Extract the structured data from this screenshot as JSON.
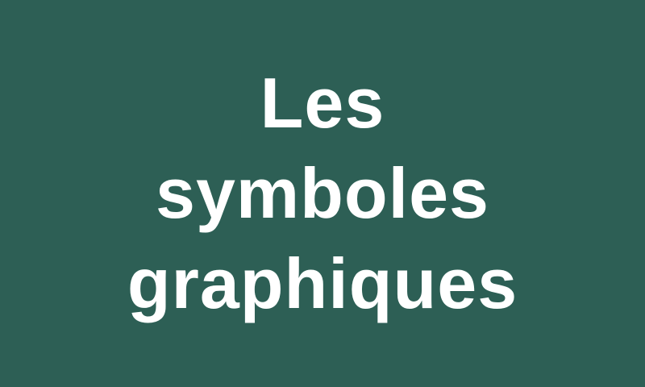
{
  "theme": {
    "background_color": "#2d5f55",
    "text_color": "#ffffff"
  },
  "title": {
    "lines": [
      "Les",
      "symboles",
      "graphiques"
    ]
  }
}
